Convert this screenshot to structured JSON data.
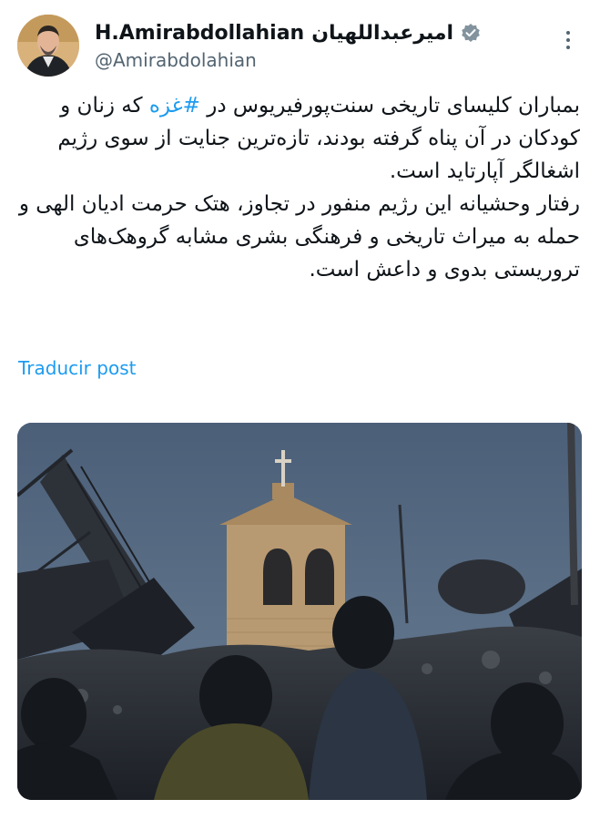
{
  "tweet": {
    "author": {
      "display_name_latin": "H.Amirabdollahian",
      "display_name_persian": "امیرعبداللهیان",
      "handle": "@Amirabdolahian",
      "avatar_icon": "profile-photo",
      "verified_icon": "verified-badge-icon"
    },
    "text": {
      "p1_before": "بمباران کلیسای تاریخی سنت‌پورفیریوس در ",
      "p1_hashtag": "#غزه",
      "p1_after": " که زنان و کودکان در آن پناه گرفته بودند، تازه‌ترین جنایت از سوی رژیم اشغالگر آپارتاید است.",
      "p2": "رفتار وحشیانه این رژیم منفور در تجاوز، هتک حرمت ادیان الهی و حمله به میراث تاریخی و فرهنگی بشری مشابه گروهک‌های تروریستی بدوی و داعش است."
    },
    "translate_label": "Traducir post",
    "more_icon": "more-options-icon",
    "media_description_icon": "church-photo-image"
  },
  "colors": {
    "accent": "#1d9bf0",
    "text": "#0f1419",
    "secondary_text": "#536471"
  }
}
